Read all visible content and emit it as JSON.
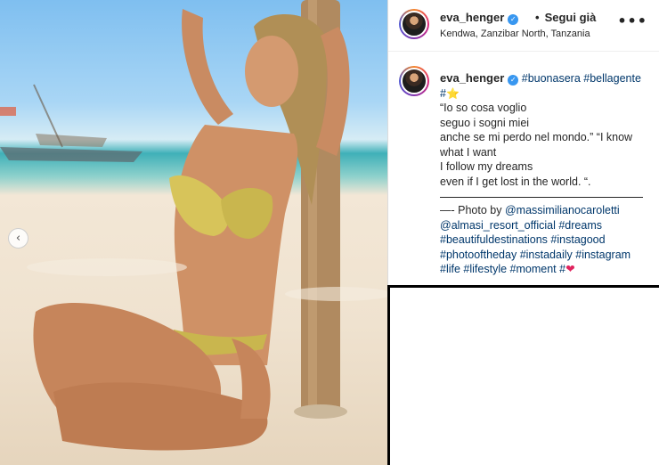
{
  "post": {
    "username": "eva_henger",
    "verified_glyph": "✓",
    "follow_separator": "•",
    "follow_label": "Segui già",
    "location": "Kendwa, Zanzibar North, Tanzania",
    "more_glyph": "•••"
  },
  "caption": {
    "username": "eva_henger",
    "hashtags_top": [
      "#buonasera",
      "#bellagente",
      "#"
    ],
    "star_glyph": "⭐",
    "lines": [
      "“Io so cosa voglio",
      "seguo i sogni miei",
      "anche se mi perdo nel mondo.” “I know",
      "what I want",
      "I follow my dreams",
      "even if I get lost in the world. “."
    ],
    "credit_prefix": "—- Photo by",
    "mentions": [
      "@massimilianocaroletti",
      "@almasi_resort_official"
    ],
    "hashtags_bottom": [
      "#dreams",
      "#beautifuldestinations",
      "#instagood",
      "#photooftheday",
      "#instadaily",
      "#instagram",
      "#life",
      "#lifestyle",
      "#moment",
      "#"
    ],
    "heart_glyph": "❤"
  },
  "carousel": {
    "prev_glyph": "‹"
  },
  "icons": {
    "prev": "chevron-left-icon",
    "verified": "verified-badge-icon",
    "more": "more-options-icon"
  },
  "colors": {
    "link": "#00376b",
    "verified": "#3897f0",
    "heart": "#e0245e"
  }
}
